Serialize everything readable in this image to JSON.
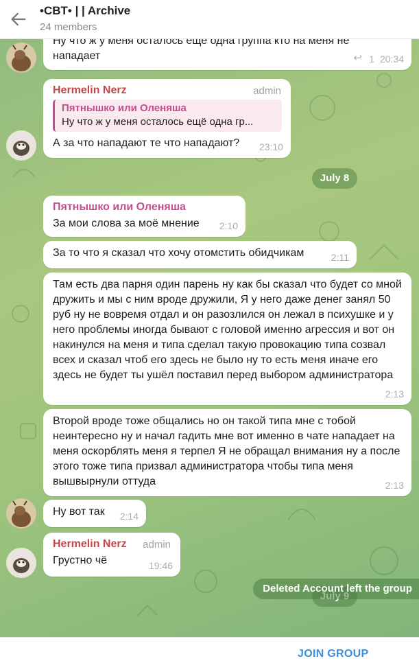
{
  "header": {
    "title": "•CBT• | | Archive",
    "members": "24 members"
  },
  "messages": [
    {
      "text": "Ну что ж у меня осталось еще одна группа кто на меня не нападает",
      "replies": "1",
      "time": "20:34"
    },
    {
      "sender": "Hermelin Nerz",
      "role": "admin",
      "reply_name": "Пятнышко или Оленяша",
      "reply_text": "Ну что ж у меня осталось ещё одна гр...",
      "text": "А за что нападают те что нападают?",
      "time": "23:10"
    },
    {
      "date": "July 8"
    },
    {
      "sender": "Пятнышко или Оленяша",
      "text": "За мои слова за моё мнение",
      "time": "2:10"
    },
    {
      "text": "За то что я сказал что хочу отомстить обидчикам",
      "time": "2:11"
    },
    {
      "text": "Там есть два парня один парень ну как бы сказал что будет со мной дружить и мы с ним вроде дружили, Я у него даже денег занял 50 руб ну не вовремя отдал и он разозлился он лежал в психушке и у него проблемы иногда бывают с головой именно агрессия и вот он накинулся на меня и типа сделал такую провокацию типа созвал всех и сказал чтоб его здесь не было ну то есть меня иначе его здесь не будет ты ушёл поставил перед выбором администратора",
      "time": "2:13"
    },
    {
      "text": "Второй вроде тоже общались но он такой типа мне с тобой неинтересно ну и начал гадить мне вот именно в чате нападает на меня оскорблять меня я терпел Я не обращал внимания ну а после этого тоже типа призвал администратора чтобы типа меня вышвырнули оттуда",
      "time": "2:13"
    },
    {
      "text": "Ну вот так",
      "time": "2:14"
    },
    {
      "sender": "Hermelin Nerz",
      "role": "admin",
      "text": "Грустно чё",
      "time": "19:46"
    },
    {
      "date": "July 9"
    }
  ],
  "service_message": "Deleted Account left the group",
  "footer": {
    "join_label": "JOIN GROUP"
  },
  "colors": {
    "accent": "#3a8fd9",
    "admin_name": "#c4464b",
    "user_name": "#c44c8f",
    "bubble": "#ffffff",
    "background": "#a9c77f"
  },
  "icons": {
    "back": "arrow-left-icon",
    "reply_count": "reply-arrow-icon"
  }
}
